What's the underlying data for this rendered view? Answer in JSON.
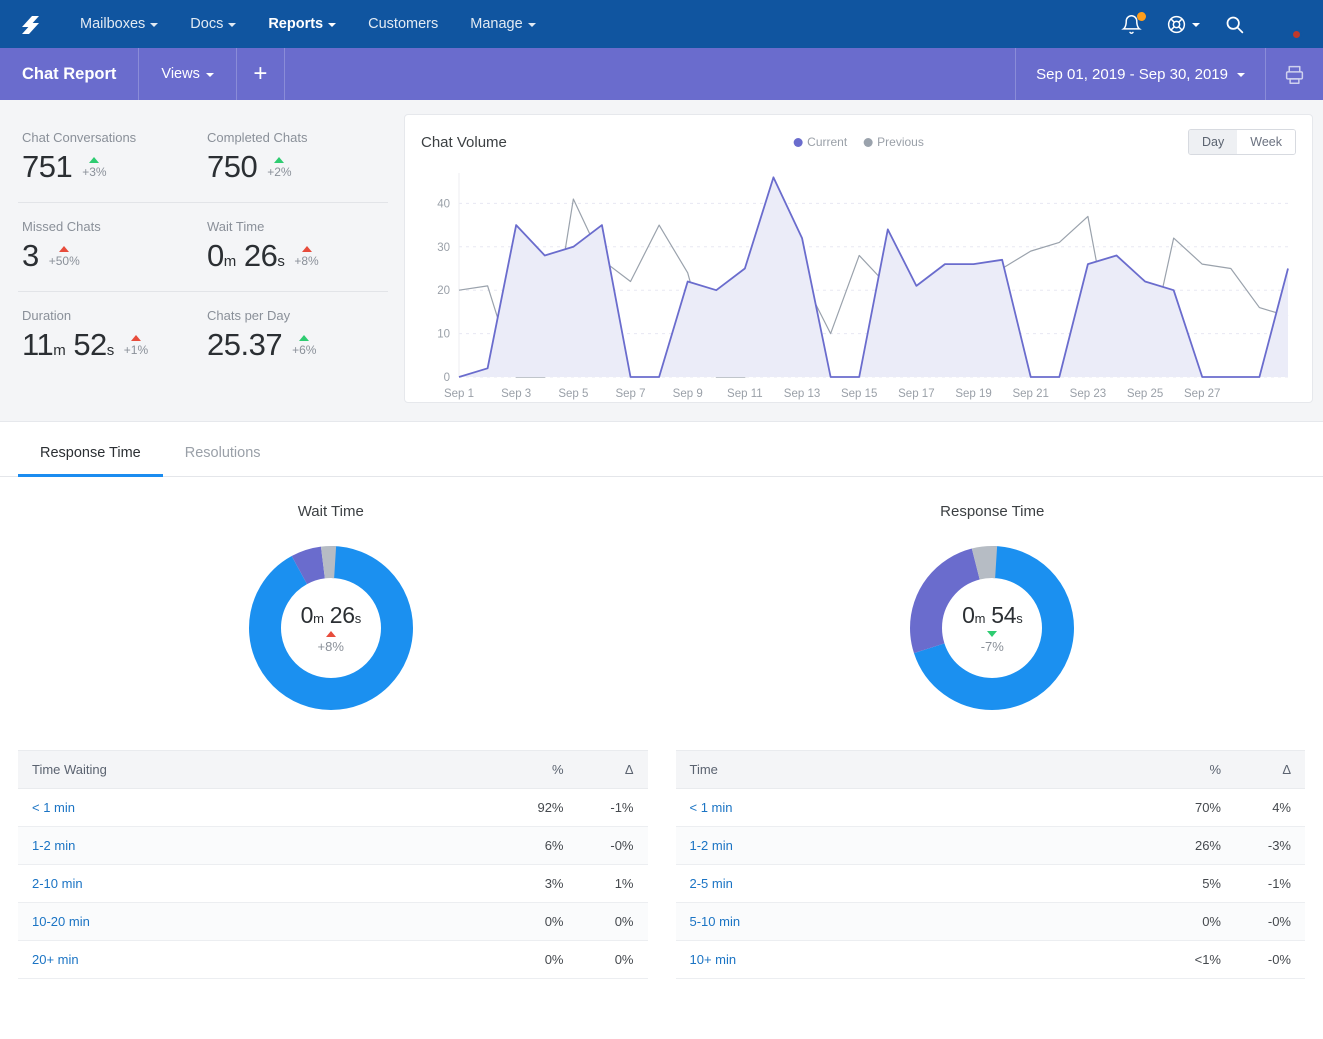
{
  "topnav": {
    "logo_icon": "helpscout-logo-icon",
    "items": [
      {
        "label": "Mailboxes",
        "has_caret": true,
        "active": false
      },
      {
        "label": "Docs",
        "has_caret": true,
        "active": false
      },
      {
        "label": "Reports",
        "has_caret": true,
        "active": true
      },
      {
        "label": "Customers",
        "has_caret": false,
        "active": false
      },
      {
        "label": "Manage",
        "has_caret": true,
        "active": false
      }
    ],
    "notifications_icon": "bell-icon",
    "help_icon": "lifebuoy-icon",
    "search_icon": "search-icon",
    "avatar_icon": "user-avatar"
  },
  "subnav": {
    "title": "Chat Report",
    "views_label": "Views",
    "add_label": "+",
    "date_range": "Sep 01, 2019 - Sep 30, 2019",
    "print_icon": "printer-icon"
  },
  "kpis": [
    {
      "label": "Chat Conversations",
      "value": "751",
      "unit1": "",
      "value2": "",
      "unit2": "",
      "delta": "+3%",
      "dir": "up",
      "dir_color": "#2ecc71"
    },
    {
      "label": "Completed Chats",
      "value": "750",
      "unit1": "",
      "value2": "",
      "unit2": "",
      "delta": "+2%",
      "dir": "up",
      "dir_color": "#2ecc71"
    },
    {
      "label": "Missed Chats",
      "value": "3",
      "unit1": "",
      "value2": "",
      "unit2": "",
      "delta": "+50%",
      "dir": "up",
      "dir_color": "#e74c3c"
    },
    {
      "label": "Wait Time",
      "value": "0",
      "unit1": "m",
      "value2": "26",
      "unit2": "s",
      "delta": "+8%",
      "dir": "up",
      "dir_color": "#e74c3c"
    },
    {
      "label": "Duration",
      "value": "11",
      "unit1": "m",
      "value2": "52",
      "unit2": "s",
      "delta": "+1%",
      "dir": "up",
      "dir_color": "#e74c3c"
    },
    {
      "label": "Chats per Day",
      "value": "25.37",
      "unit1": "",
      "value2": "",
      "unit2": "",
      "delta": "+6%",
      "dir": "up",
      "dir_color": "#2ecc71"
    }
  ],
  "chart_card": {
    "title": "Chat Volume",
    "legend": [
      {
        "label": "Current",
        "color": "#6a6ccd"
      },
      {
        "label": "Previous",
        "color": "#9aa2ac"
      }
    ],
    "toggle": {
      "options": [
        "Day",
        "Week"
      ],
      "selected": "Day"
    }
  },
  "chart_data": {
    "type": "line",
    "title": "Chat Volume",
    "xlabel": "",
    "ylabel": "",
    "ylim": [
      0,
      47
    ],
    "yticks": [
      0,
      10,
      20,
      30,
      40
    ],
    "grid": true,
    "legend_position": "top-center",
    "x": [
      "Sep 1",
      "Sep 2",
      "Sep 3",
      "Sep 4",
      "Sep 5",
      "Sep 6",
      "Sep 7",
      "Sep 8",
      "Sep 9",
      "Sep 10",
      "Sep 11",
      "Sep 12",
      "Sep 13",
      "Sep 14",
      "Sep 15",
      "Sep 16",
      "Sep 17",
      "Sep 18",
      "Sep 19",
      "Sep 20",
      "Sep 21",
      "Sep 22",
      "Sep 23",
      "Sep 24",
      "Sep 25",
      "Sep 26",
      "Sep 27",
      "Sep 28",
      "Sep 29",
      "Sep 30"
    ],
    "xticks": [
      "Sep 1",
      "Sep 3",
      "Sep 5",
      "Sep 7",
      "Sep 9",
      "Sep 11",
      "Sep 13",
      "Sep 15",
      "Sep 17",
      "Sep 19",
      "Sep 21",
      "Sep 23",
      "Sep 25",
      "Sep 27"
    ],
    "series": [
      {
        "name": "Current",
        "color": "#6a6ccd",
        "fill": "#ebecf8",
        "values": [
          0,
          2,
          35,
          28,
          30,
          35,
          0,
          0,
          22,
          20,
          25,
          46,
          32,
          0,
          0,
          34,
          21,
          26,
          26,
          27,
          0,
          0,
          26,
          28,
          22,
          20,
          0,
          0,
          0,
          25
        ]
      },
      {
        "name": "Previous",
        "color": "#9aa2ac",
        "fill": "none",
        "values": [
          20,
          21,
          0,
          0,
          41,
          27,
          22,
          35,
          24,
          0,
          0,
          10,
          23,
          10,
          28,
          21,
          2,
          2,
          25,
          25,
          29,
          31,
          37,
          2,
          2,
          32,
          26,
          25,
          16,
          14
        ]
      }
    ]
  },
  "tabs": [
    {
      "label": "Response Time",
      "active": true
    },
    {
      "label": "Resolutions",
      "active": false
    }
  ],
  "donuts": [
    {
      "title": "Wait Time",
      "value": "0",
      "unit1": "m",
      "value2": "26",
      "unit2": "s",
      "delta": "+8%",
      "dir": "up",
      "dir_color": "#e74c3c",
      "segments": [
        {
          "label": "< 1 min",
          "pct": 92,
          "color": "#1b90f0"
        },
        {
          "label": "1-2 min",
          "pct": 6,
          "color": "#6a6ccd"
        },
        {
          "label": "2-10 min",
          "pct": 3,
          "color": "#b6bcc4"
        }
      ]
    },
    {
      "title": "Response Time",
      "value": "0",
      "unit1": "m",
      "value2": "54",
      "unit2": "s",
      "delta": "-7%",
      "dir": "down",
      "dir_color": "#2ecc71",
      "segments": [
        {
          "label": "< 1 min",
          "pct": 70,
          "color": "#1b90f0"
        },
        {
          "label": "1-2 min",
          "pct": 26,
          "color": "#6a6ccd"
        },
        {
          "label": "2-5 min",
          "pct": 5,
          "color": "#b6bcc4"
        }
      ]
    }
  ],
  "tables": [
    {
      "headers": [
        "Time Waiting",
        "%",
        "Δ"
      ],
      "rows": [
        {
          "name": "< 1 min",
          "pct": "92%",
          "delta": "-1%"
        },
        {
          "name": "1-2 min",
          "pct": "6%",
          "delta": "-0%"
        },
        {
          "name": "2-10 min",
          "pct": "3%",
          "delta": "1%"
        },
        {
          "name": "10-20 min",
          "pct": "0%",
          "delta": "0%"
        },
        {
          "name": "20+ min",
          "pct": "0%",
          "delta": "0%"
        }
      ]
    },
    {
      "headers": [
        "Time",
        "%",
        "Δ"
      ],
      "rows": [
        {
          "name": "< 1 min",
          "pct": "70%",
          "delta": "4%"
        },
        {
          "name": "1-2 min",
          "pct": "26%",
          "delta": "-3%"
        },
        {
          "name": "2-5 min",
          "pct": "5%",
          "delta": "-1%"
        },
        {
          "name": "5-10 min",
          "pct": "0%",
          "delta": "-0%"
        },
        {
          "name": "10+ min",
          "pct": "<1%",
          "delta": "-0%"
        }
      ]
    }
  ]
}
